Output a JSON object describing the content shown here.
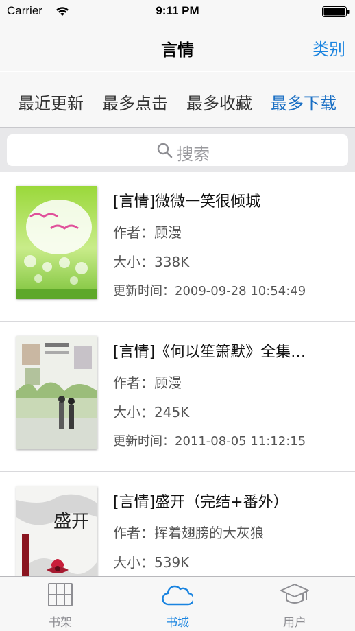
{
  "status_bar": {
    "carrier": "Carrier",
    "time": "9:11 PM",
    "icons": [
      "wifi-icon",
      "battery-icon"
    ]
  },
  "nav": {
    "title": "言情",
    "right_button": "类别"
  },
  "filters": {
    "tabs": [
      "最近更新",
      "最多点击",
      "最多收藏",
      "最多下载"
    ],
    "active_index": 3
  },
  "search": {
    "placeholder": "搜索",
    "icon": "search-icon"
  },
  "books": [
    {
      "title": "[言情]微微一笑很倾城",
      "author": "作者：顾漫",
      "size": "大小：338K",
      "updated": "更新时间：2009-09-28 10:54:49"
    },
    {
      "title": "[言情]《何以笙箫默》全集…",
      "author": "作者：顾漫",
      "size": "大小：245K",
      "updated": "更新时间：2011-08-05 11:12:15"
    },
    {
      "title": "[言情]盛开（完结+番外）",
      "author": "作者：挥着翅膀的大灰狼",
      "size": "大小：539K",
      "updated": ""
    }
  ],
  "cover_text": {
    "book3": "盛开"
  },
  "tab_bar": {
    "items": [
      {
        "label": "书架",
        "icon": "bookshelf-icon"
      },
      {
        "label": "书城",
        "icon": "cloud-icon"
      },
      {
        "label": "用户",
        "icon": "graduation-cap-icon"
      }
    ],
    "active_index": 1
  },
  "colors": {
    "accent": "#1a84e0",
    "active_filter": "#1a6fc4",
    "bar_background": "#f7f7f7",
    "inactive_tab": "#8e8e93"
  }
}
